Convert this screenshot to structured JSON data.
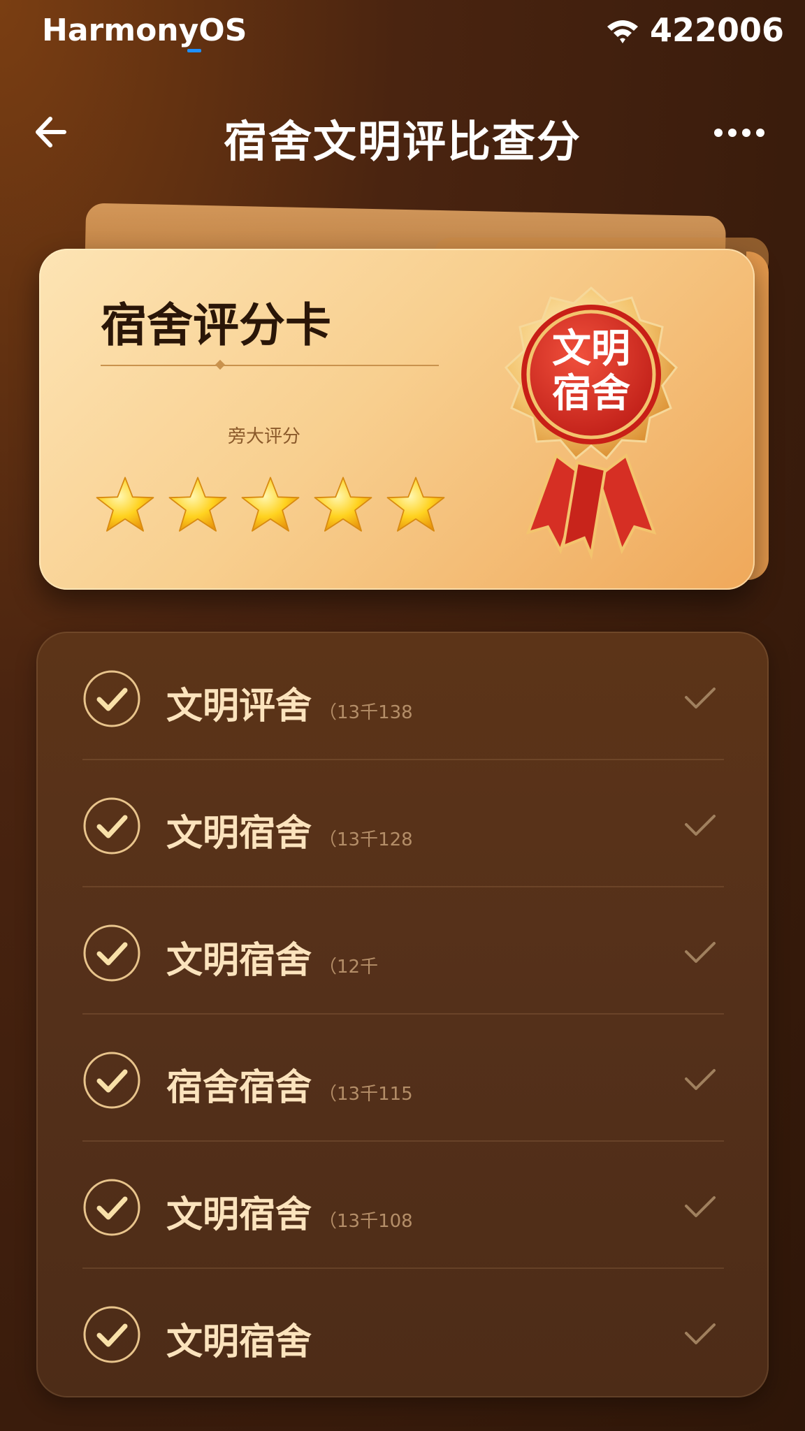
{
  "status_bar": {
    "os_name": "HarmonyOS",
    "number": "422006",
    "signal_icon": "wifi-icon"
  },
  "header": {
    "title": "宿舍文明评比查分",
    "back_icon": "arrow-left-icon",
    "more_icon": "more-dots-icon"
  },
  "score_card": {
    "title": "宿舍评分卡",
    "subtitle": "旁大评分",
    "stars": 5,
    "stars_max": 5,
    "badge_line1": "文明",
    "badge_line2": "宿舍"
  },
  "list": {
    "items": [
      {
        "label": "文明评舍",
        "note": "（13千138",
        "checked": true
      },
      {
        "label": "文明宿舍",
        "note": "（13千128",
        "checked": true
      },
      {
        "label": "文明宿舍",
        "note": "（12千",
        "checked": true
      },
      {
        "label": "宿舍宿舍",
        "note": "（13千115",
        "checked": true
      },
      {
        "label": "文明宿舍",
        "note": "（13千108",
        "checked": true
      },
      {
        "label": "文明宿舍",
        "note": "",
        "checked": true
      }
    ]
  },
  "colors": {
    "background": "#3a1c0c",
    "card_light": "#fde4b4",
    "card_dark": "#efa85a",
    "badge_red": "#d62f24",
    "list_text": "#fbe3bd",
    "check_gold": "#f3d9a8"
  }
}
